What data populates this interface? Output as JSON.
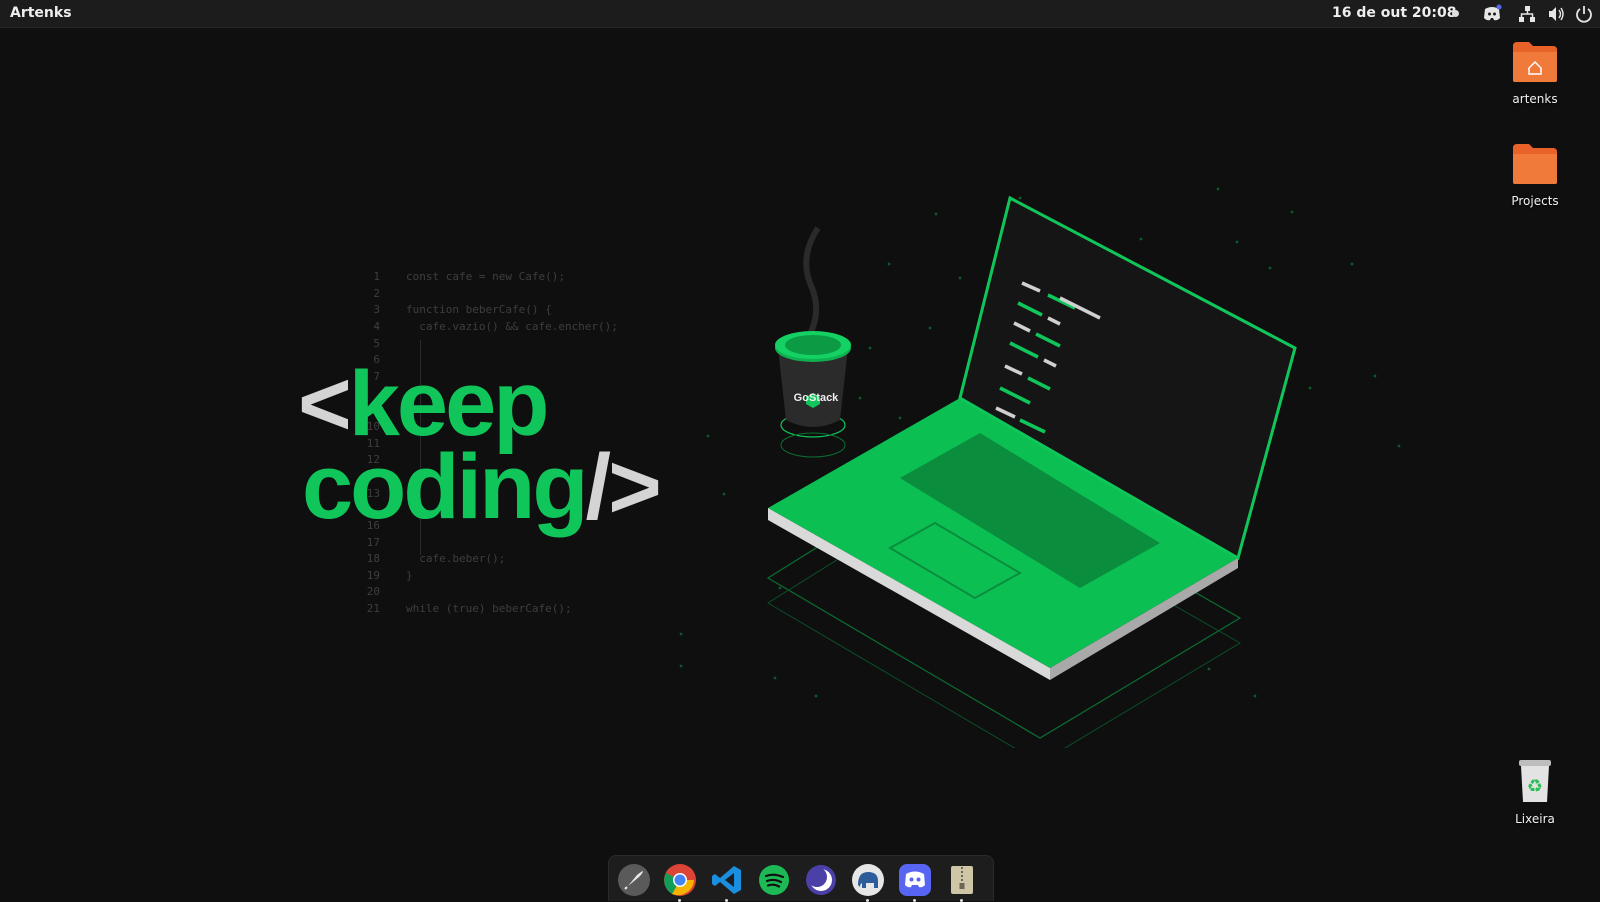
{
  "topbar": {
    "app_name": "Artenks",
    "clock": "16 de out  20:08",
    "tray": [
      "discord-icon",
      "network-icon",
      "volume-icon",
      "power-icon"
    ]
  },
  "wallpaper": {
    "code": [
      {
        "n": "1",
        "t": "const cafe = new Cafe();"
      },
      {
        "n": "2",
        "t": ""
      },
      {
        "n": "3",
        "t": "function beberCafe() {"
      },
      {
        "n": "4",
        "t": "  cafe.vazio() && cafe.encher();"
      },
      {
        "n": "5",
        "t": ""
      },
      {
        "n": "6",
        "t": ""
      },
      {
        "n": "7",
        "t": ""
      },
      {
        "n": "10",
        "t": ""
      },
      {
        "n": "11",
        "t": ""
      },
      {
        "n": "12",
        "t": ""
      },
      {
        "n": "13",
        "t": ""
      },
      {
        "n": "16",
        "t": ""
      },
      {
        "n": "17",
        "t": ""
      },
      {
        "n": "18",
        "t": "  cafe.beber();"
      },
      {
        "n": "19",
        "t": "}"
      },
      {
        "n": "20",
        "t": ""
      },
      {
        "n": "21",
        "t": "while (true) beberCafe();"
      }
    ],
    "headline_line1_bracket": "<",
    "headline_line1_word": "keep",
    "headline_line2_word": "coding",
    "headline_line2_bracket": "/>",
    "cup_brand": "GoStack",
    "colors": {
      "accent": "#10c65a",
      "background": "#0f0f0f"
    }
  },
  "desktop": {
    "icons": [
      {
        "label": "artenks",
        "icon": "home-folder-icon"
      },
      {
        "label": "Projects",
        "icon": "folder-icon"
      },
      {
        "label": "Lixeira",
        "icon": "trash-icon"
      }
    ]
  },
  "dock": {
    "apps": [
      {
        "name": "launcher",
        "icon": "rocket-icon"
      },
      {
        "name": "chrome",
        "icon": "chrome-icon"
      },
      {
        "name": "vscode",
        "icon": "vscode-icon"
      },
      {
        "name": "spotify",
        "icon": "spotify-icon"
      },
      {
        "name": "moon-app",
        "icon": "moon-icon"
      },
      {
        "name": "database-app",
        "icon": "elephant-icon"
      },
      {
        "name": "discord",
        "icon": "discord-icon"
      },
      {
        "name": "archive-manager",
        "icon": "archive-icon"
      }
    ]
  }
}
